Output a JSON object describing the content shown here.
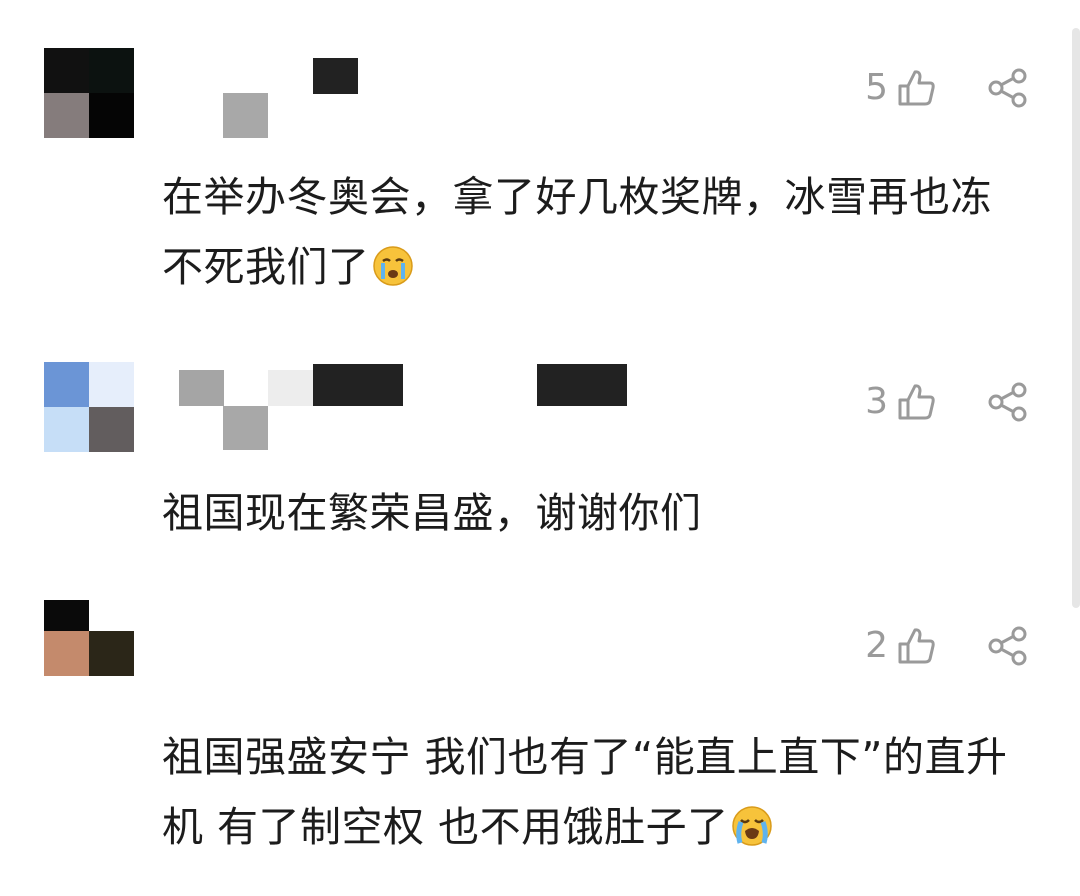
{
  "comments": [
    {
      "likes": "5",
      "text": "在举办冬奥会，拿了好几枚奖牌，冰雪再也冻不死我们了",
      "emoji": "crying-face"
    },
    {
      "likes": "3",
      "text": "祖国现在繁荣昌盛，谢谢你们",
      "emoji": ""
    },
    {
      "likes": "2",
      "text": "祖国强盛安宁 我们也有了“能直上直下”的直升机 有了制空权 也不用饿肚子了",
      "emoji": "loudly-crying-face"
    }
  ],
  "icons": {
    "like": "thumbs-up-outline-icon",
    "share": "share-icon"
  },
  "colors": {
    "text": "#1c1c1c",
    "muted": "#9a9a9a",
    "icon": "#9a9a9a",
    "censor": "#222222"
  }
}
